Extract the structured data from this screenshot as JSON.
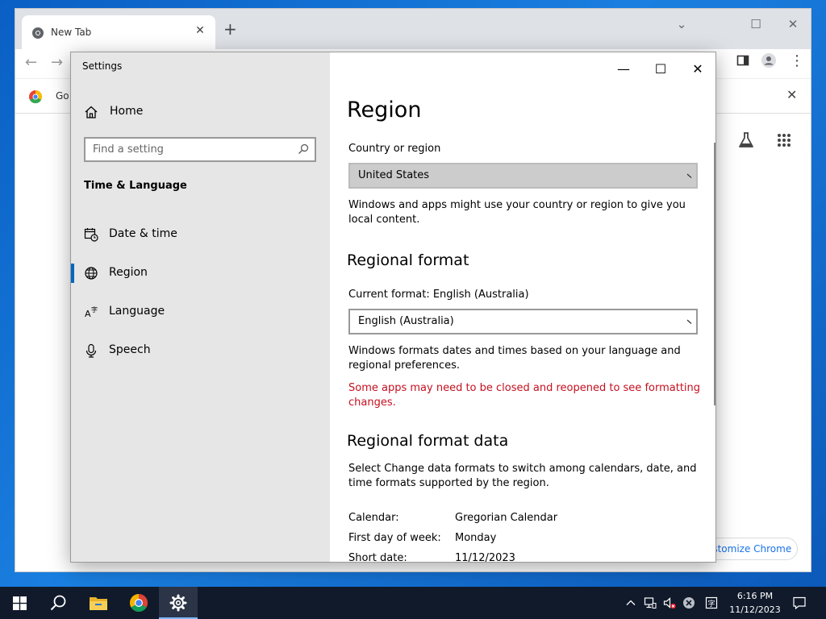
{
  "browser": {
    "tab_title": "New Tab",
    "bookmark_label": "Go",
    "customize_label": "ıstomize Chrome"
  },
  "settings": {
    "window_title": "Settings",
    "nav": {
      "home_label": "Home",
      "search_placeholder": "Find a setting",
      "section_title": "Time & Language",
      "items": [
        {
          "label": "Date & time",
          "icon": "calendar-clock-icon"
        },
        {
          "label": "Region",
          "icon": "globe-icon",
          "active": true
        },
        {
          "label": "Language",
          "icon": "language-icon"
        },
        {
          "label": "Speech",
          "icon": "microphone-icon"
        }
      ]
    },
    "page": {
      "title": "Region",
      "country_label": "Country or region",
      "country_value": "United States",
      "country_desc": "Windows and apps might use your country or region to give you local content.",
      "format_heading": "Regional format",
      "current_format_label": "Current format: English (Australia)",
      "format_value": "English (Australia)",
      "format_desc": "Windows formats dates and times based on your language and regional preferences.",
      "format_warning": "Some apps may need to be closed and reopened to see formatting changes.",
      "data_heading": "Regional format data",
      "data_desc": "Select Change data formats to switch among calendars, date, and time formats supported by the region.",
      "format_data": [
        {
          "key": "Calendar:",
          "value": "Gregorian Calendar"
        },
        {
          "key": "First day of week:",
          "value": "Monday"
        },
        {
          "key": "Short date:",
          "value": "11/12/2023"
        }
      ]
    }
  },
  "taskbar": {
    "time": "6:16 PM",
    "date": "11/12/2023"
  },
  "colors": {
    "accent": "#0067c0",
    "warning": "#c50f1f",
    "nav_bg": "#e6e6e6",
    "taskbar_bg": "#101a2b"
  }
}
